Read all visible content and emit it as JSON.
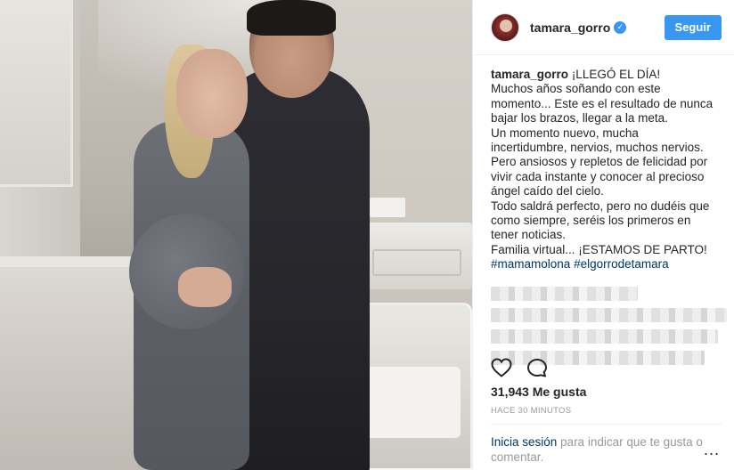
{
  "header": {
    "username": "tamara_gorro",
    "verified_icon": "verified-badge-icon",
    "follow_label": "Seguir"
  },
  "caption": {
    "username": "tamara_gorro",
    "lines": [
      "¡LLEGÓ EL DÍA!",
      "Muchos años soñando con este",
      "momento... Este es el resultado de nunca",
      "bajar los brazos, llegar a la meta.",
      "Un momento nuevo, mucha",
      "incertidumbre, nervios, muchos nervios.",
      "Pero ansiosos y repletos de felicidad por",
      "vivir cada instante y conocer al precioso",
      "ángel caído del cielo.",
      "Todo saldrá perfecto, pero no dudéis que",
      "como siempre, seréis los primeros en",
      "tener noticias.",
      "Familia virtual... ¡ESTAMOS DE PARTO!"
    ],
    "hashtags": [
      "#mamamolona",
      "#elgorrodetamara"
    ]
  },
  "actions": {
    "like_icon": "heart-icon",
    "comment_icon": "comment-icon"
  },
  "likes": "31,943 Me gusta",
  "time": "HACE 30 MINUTOS",
  "footer": {
    "login_link": "Inicia sesión",
    "login_text": " para indicar que te gusta o comentar.",
    "more_label": "..."
  },
  "colors": {
    "accent": "#3897f0",
    "link": "#003569",
    "muted": "#999999"
  }
}
